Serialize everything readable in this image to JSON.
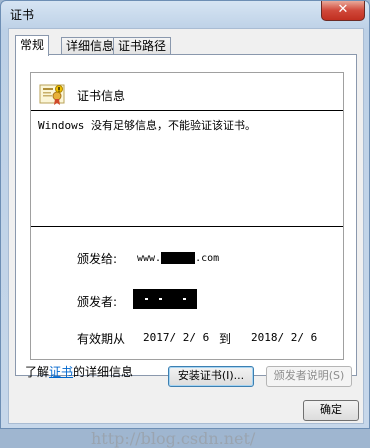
{
  "window": {
    "title": "证书",
    "close_glyph": "✕"
  },
  "tabs": [
    {
      "label": "常规",
      "active": true
    },
    {
      "label": "详细信息",
      "active": false
    },
    {
      "label": "证书路径",
      "active": false
    }
  ],
  "cert": {
    "heading": "证书信息",
    "warning": "Windows 没有足够信息，不能验证该证书。",
    "issued_to_label": "颁发给:",
    "issued_to_prefix": "www.",
    "issued_to_suffix": ".com",
    "issued_by_label": "颁发者:",
    "validity_label": "有效期从",
    "valid_from": "2017/ 2/ 6",
    "to_label": "到",
    "valid_to": "2018/ 2/ 6"
  },
  "buttons": {
    "install": "安装证书(I)...",
    "issuer_statement": "颁发者说明(S)",
    "ok": "确定"
  },
  "footer": {
    "learn_prefix": "了解",
    "learn_link": "证书",
    "learn_suffix": "的详细信息"
  },
  "watermark": "http://blog.csdn.net/",
  "icons": {
    "cert": "certificate-icon",
    "close": "close-icon"
  },
  "colors": {
    "link": "#0066cc",
    "close": "#c12f20"
  }
}
